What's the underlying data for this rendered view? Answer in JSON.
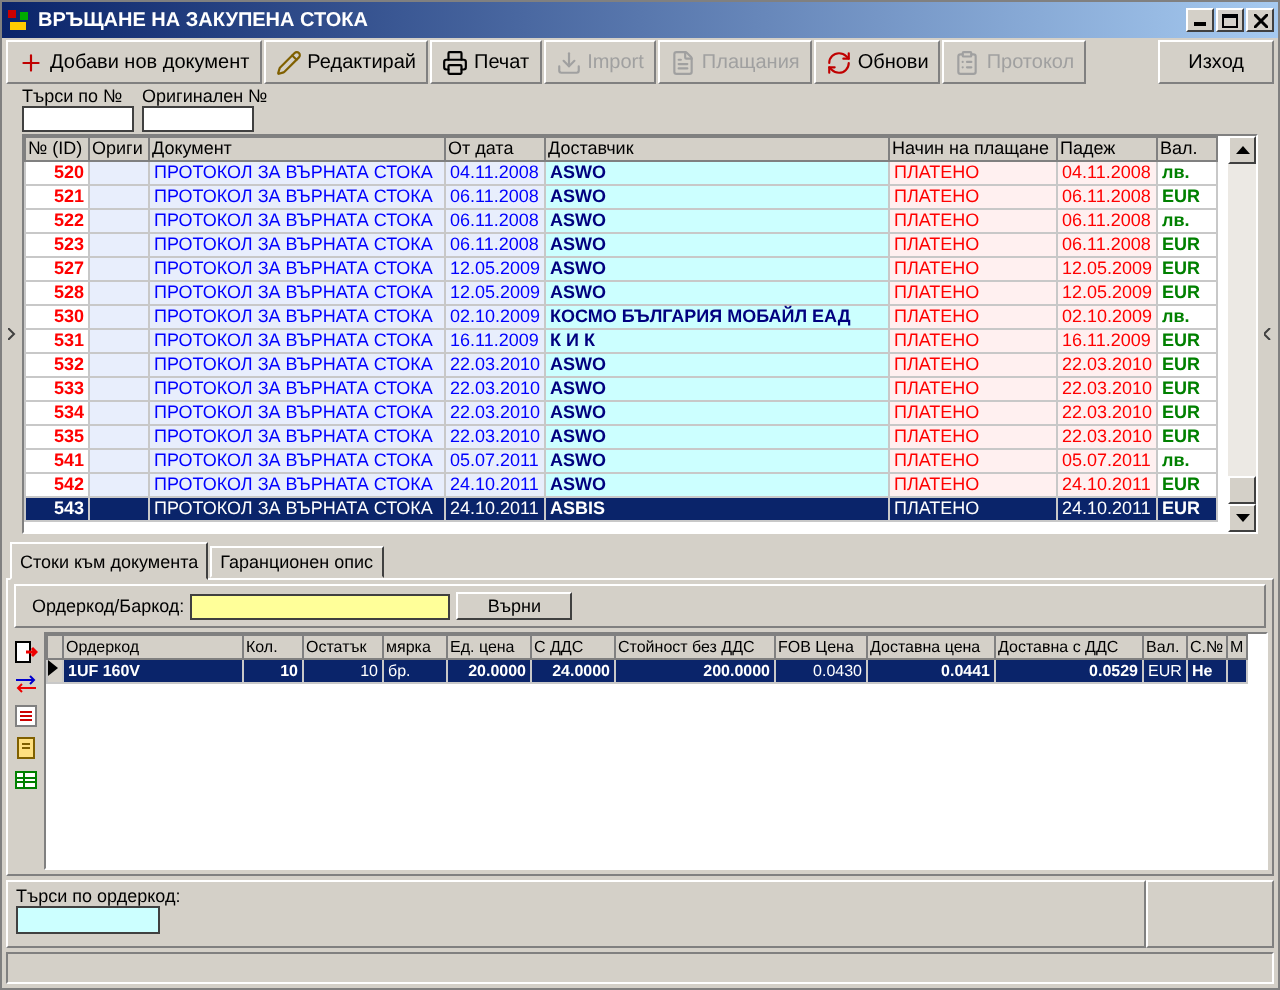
{
  "window": {
    "title": "ВРЪЩАНЕ НА ЗАКУПЕНА СТОКА"
  },
  "toolbar": [
    {
      "kind": "add",
      "label": "Добави нов документ",
      "disabled": false
    },
    {
      "kind": "edit",
      "label": "Редактирай",
      "disabled": false
    },
    {
      "kind": "print",
      "label": "Печат",
      "disabled": false
    },
    {
      "kind": "import",
      "label": "Import",
      "disabled": true
    },
    {
      "kind": "payments",
      "label": "Плащания",
      "disabled": true
    },
    {
      "kind": "refresh",
      "label": "Обнови",
      "disabled": false
    },
    {
      "kind": "protocol",
      "label": "Протокол",
      "disabled": true
    }
  ],
  "exit_button": "Изход",
  "filters": [
    {
      "label": "Търси по №"
    },
    {
      "label": "Оригинален №"
    }
  ],
  "documents": {
    "columns": [
      "№ (ID)",
      "Ориги",
      "Документ",
      "От дата",
      "Доставчик",
      "Начин на плащане",
      "Падеж",
      "Вал."
    ],
    "rows": [
      {
        "id": "520",
        "document": "ПРОТОКОЛ ЗА ВЪРНАТА СТОКА",
        "date": "04.11.2008",
        "supplier": "ASWO",
        "payment": "ПЛАТЕНО",
        "due": "04.11.2008",
        "currency": "лв.",
        "selected": false
      },
      {
        "id": "521",
        "document": "ПРОТОКОЛ ЗА ВЪРНАТА СТОКА",
        "date": "06.11.2008",
        "supplier": "ASWO",
        "payment": "ПЛАТЕНО",
        "due": "06.11.2008",
        "currency": "EUR",
        "selected": false
      },
      {
        "id": "522",
        "document": "ПРОТОКОЛ ЗА ВЪРНАТА СТОКА",
        "date": "06.11.2008",
        "supplier": "ASWO",
        "payment": "ПЛАТЕНО",
        "due": "06.11.2008",
        "currency": "лв.",
        "selected": false
      },
      {
        "id": "523",
        "document": "ПРОТОКОЛ ЗА ВЪРНАТА СТОКА",
        "date": "06.11.2008",
        "supplier": "ASWO",
        "payment": "ПЛАТЕНО",
        "due": "06.11.2008",
        "currency": "EUR",
        "selected": false
      },
      {
        "id": "527",
        "document": "ПРОТОКОЛ ЗА ВЪРНАТА СТОКА",
        "date": "12.05.2009",
        "supplier": "ASWO",
        "payment": "ПЛАТЕНО",
        "due": "12.05.2009",
        "currency": "EUR",
        "selected": false
      },
      {
        "id": "528",
        "document": "ПРОТОКОЛ ЗА ВЪРНАТА СТОКА",
        "date": "12.05.2009",
        "supplier": "ASWO",
        "payment": "ПЛАТЕНО",
        "due": "12.05.2009",
        "currency": "EUR",
        "selected": false
      },
      {
        "id": "530",
        "document": "ПРОТОКОЛ ЗА ВЪРНАТА СТОКА",
        "date": "02.10.2009",
        "supplier": "КОСМО БЪЛГАРИЯ МОБАЙЛ ЕАД",
        "payment": "ПЛАТЕНО",
        "due": "02.10.2009",
        "currency": "лв.",
        "selected": false
      },
      {
        "id": "531",
        "document": "ПРОТОКОЛ ЗА ВЪРНАТА СТОКА",
        "date": "16.11.2009",
        "supplier": "К И К",
        "payment": "ПЛАТЕНО",
        "due": "16.11.2009",
        "currency": "EUR",
        "selected": false
      },
      {
        "id": "532",
        "document": "ПРОТОКОЛ ЗА ВЪРНАТА СТОКА",
        "date": "22.03.2010",
        "supplier": "ASWO",
        "payment": "ПЛАТЕНО",
        "due": "22.03.2010",
        "currency": "EUR",
        "selected": false
      },
      {
        "id": "533",
        "document": "ПРОТОКОЛ ЗА ВЪРНАТА СТОКА",
        "date": "22.03.2010",
        "supplier": "ASWO",
        "payment": "ПЛАТЕНО",
        "due": "22.03.2010",
        "currency": "EUR",
        "selected": false
      },
      {
        "id": "534",
        "document": "ПРОТОКОЛ ЗА ВЪРНАТА СТОКА",
        "date": "22.03.2010",
        "supplier": "ASWO",
        "payment": "ПЛАТЕНО",
        "due": "22.03.2010",
        "currency": "EUR",
        "selected": false
      },
      {
        "id": "535",
        "document": "ПРОТОКОЛ ЗА ВЪРНАТА СТОКА",
        "date": "22.03.2010",
        "supplier": "ASWO",
        "payment": "ПЛАТЕНО",
        "due": "22.03.2010",
        "currency": "EUR",
        "selected": false
      },
      {
        "id": "541",
        "document": "ПРОТОКОЛ ЗА ВЪРНАТА СТОКА",
        "date": "05.07.2011",
        "supplier": "ASWO",
        "payment": "ПЛАТЕНО",
        "due": "05.07.2011",
        "currency": "лв.",
        "selected": false
      },
      {
        "id": "542",
        "document": "ПРОТОКОЛ ЗА ВЪРНАТА СТОКА",
        "date": "24.10.2011",
        "supplier": "ASWO",
        "payment": "ПЛАТЕНО",
        "due": "24.10.2011",
        "currency": "EUR",
        "selected": false
      },
      {
        "id": "543",
        "document": "ПРОТОКОЛ ЗА ВЪРНАТА СТОКА",
        "date": "24.10.2011",
        "supplier": "ASBIS",
        "payment": "ПЛАТЕНО",
        "due": "24.10.2011",
        "currency": "EUR",
        "selected": true
      }
    ]
  },
  "tabs": [
    {
      "label": "Стоки към документа",
      "selected": true
    },
    {
      "label": "Гаранционен опис",
      "selected": false
    }
  ],
  "barcode": {
    "label": "Ордеркод/Баркод:",
    "button": "Върни"
  },
  "items": {
    "columns": [
      "Ордеркод",
      "Кол.",
      "Остатък",
      "мярка",
      "Ед. цена",
      "С ДДС",
      "Стойност без ДДС",
      "FOB Цена",
      "Доставна цена",
      "Доставна с ДДС",
      "Вал.",
      "C.№",
      "М"
    ],
    "rows": [
      {
        "cells": [
          "1UF 160V",
          "10",
          "10",
          "бр.",
          "20.0000",
          "24.0000",
          "200.0000",
          "0.0430",
          "0.0441",
          "0.0529",
          "EUR",
          "Не",
          ""
        ],
        "selected": true
      }
    ]
  },
  "search_orderkod": {
    "label": "Търси по ордеркод:"
  }
}
